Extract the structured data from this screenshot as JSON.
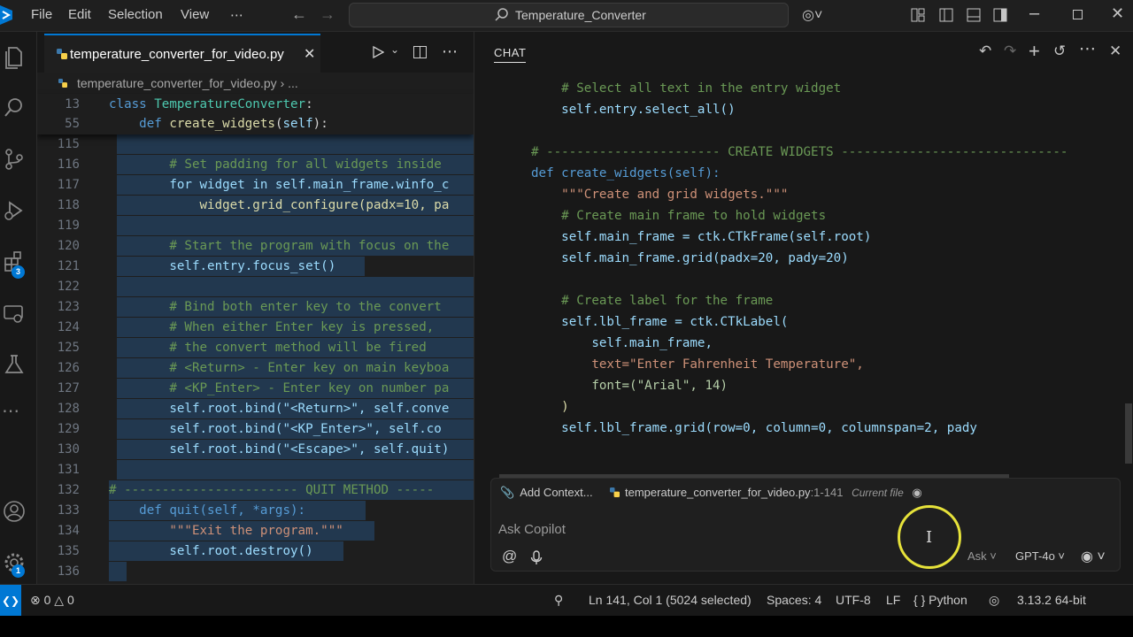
{
  "titlebar": {
    "menu": [
      "File",
      "Edit",
      "Selection",
      "View",
      "⋯"
    ],
    "search_text": "Temperature_Converter",
    "colors": {
      "accent": "#0078d4"
    }
  },
  "editor": {
    "tab_name": "temperature_converter_for_video.py",
    "breadcrumb_file": "temperature_converter_for_video.py",
    "breadcrumb_more": "...",
    "sticky": [
      {
        "num": "13",
        "text": "class TemperatureConverter:"
      },
      {
        "num": "55",
        "text": "    def create_widgets(self):"
      }
    ],
    "lines": [
      {
        "num": "115",
        "text": ""
      },
      {
        "num": "116",
        "text": "        # Set padding for all widgets inside"
      },
      {
        "num": "117",
        "text": "        for widget in self.main_frame.winfo_c"
      },
      {
        "num": "118",
        "text": "            widget.grid_configure(padx=10, pa"
      },
      {
        "num": "119",
        "text": ""
      },
      {
        "num": "120",
        "text": "        # Start the program with focus on the"
      },
      {
        "num": "121",
        "text": "        self.entry.focus_set()"
      },
      {
        "num": "122",
        "text": ""
      },
      {
        "num": "123",
        "text": "        # Bind both enter key to the convert"
      },
      {
        "num": "124",
        "text": "        # When either Enter key is pressed,"
      },
      {
        "num": "125",
        "text": "        # the convert method will be fired"
      },
      {
        "num": "126",
        "text": "        # <Return> - Enter key on main keyboa"
      },
      {
        "num": "127",
        "text": "        # <KP_Enter> - Enter key on number pa"
      },
      {
        "num": "128",
        "text": "        self.root.bind(\"<Return>\", self.conve"
      },
      {
        "num": "129",
        "text": "        self.root.bind(\"<KP_Enter>\", self.co"
      },
      {
        "num": "130",
        "text": "        self.root.bind(\"<Escape>\", self.quit)"
      },
      {
        "num": "131",
        "text": ""
      },
      {
        "num": "132",
        "text": "# ----------------------- QUIT METHOD -----"
      },
      {
        "num": "133",
        "text": "    def quit(self, *args):"
      },
      {
        "num": "134",
        "text": "        \"\"\"Exit the program.\"\"\""
      },
      {
        "num": "135",
        "text": "        self.root.destroy()"
      },
      {
        "num": "136",
        "text": ""
      }
    ]
  },
  "chat": {
    "title": "CHAT",
    "code": [
      "    # Select all text in the entry widget",
      "    self.entry.select_all()",
      "",
      "# ----------------------- CREATE WIDGETS ------------------------------",
      "def create_widgets(self):",
      "    \"\"\"Create and grid widgets.\"\"\"",
      "    # Create main frame to hold widgets",
      "    self.main_frame = ctk.CTkFrame(self.root)",
      "    self.main_frame.grid(padx=20, pady=20)",
      "",
      "    # Create label for the frame",
      "    self.lbl_frame = ctk.CTkLabel(",
      "        self.main_frame,",
      "        text=\"Enter Fahrenheit Temperature\",",
      "        font=(\"Arial\", 14)",
      "    )",
      "    self.lbl_frame.grid(row=0, column=0, columnspan=2, pady"
    ],
    "add_context": "Add Context...",
    "context_file": "temperature_converter_for_video.py",
    "context_range": ":1-141",
    "context_current": "Current file",
    "ask_placeholder": "Ask Copilot",
    "mode": "Ask",
    "model": "GPT-4o"
  },
  "status": {
    "errors": "0",
    "warnings": "0",
    "position": "Ln 141, Col 1 (5024 selected)",
    "spaces": "Spaces: 4",
    "encoding": "UTF-8",
    "eol": "LF",
    "language": "Python",
    "interpreter": "3.13.2 64-bit"
  },
  "badges": {
    "extensions": "3",
    "accounts": "1"
  }
}
